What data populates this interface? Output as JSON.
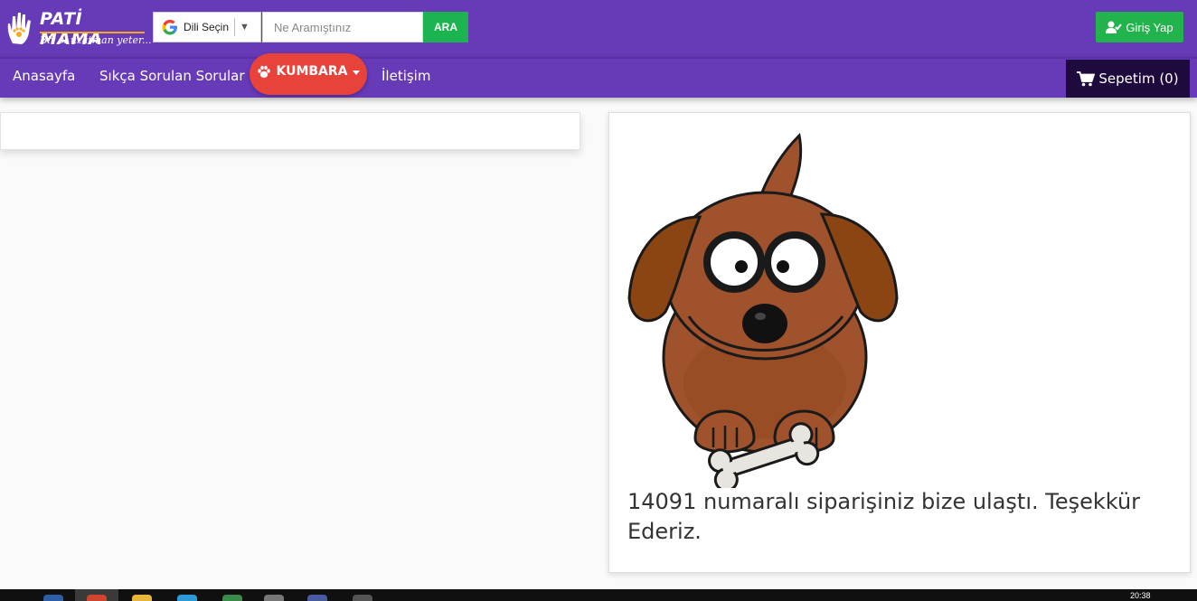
{
  "header": {
    "logo_title": "PATİ MAMA",
    "logo_tagline": "Bir el uzatman yeter...",
    "language_label": "Dili Seçin",
    "search_placeholder": "Ne Aramıştınız",
    "search_button": "ARA",
    "login_button": "Giriş Yap"
  },
  "nav": {
    "items": [
      "Anasayfa",
      "Sıkça Sorulan Sorular",
      "İletişim"
    ],
    "kumbara_label": "KUMBARA",
    "cart_label": "Sepetim (0)"
  },
  "main": {
    "order_message": "14091 numaralı siparişiniz bize ulaştı. Teşekkür Ederiz."
  },
  "taskbar": {
    "time": "20:38"
  },
  "colors": {
    "header_bg": "#673ab7",
    "kumbara_red": "#e8433b",
    "cart_bg": "#1f0a3d",
    "button_green": "#22b34d",
    "dog_brown": "#a0522d"
  }
}
